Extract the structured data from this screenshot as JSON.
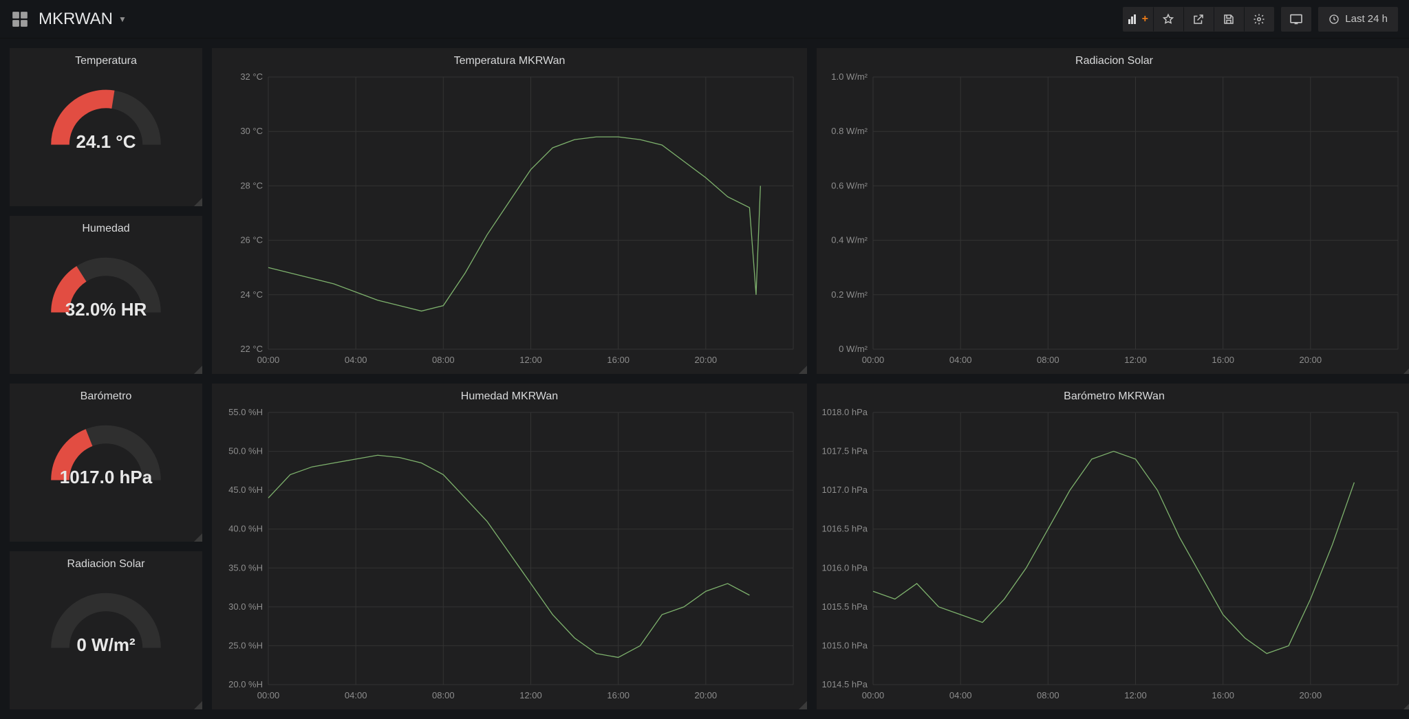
{
  "header": {
    "title": "MKRWAN",
    "time_label": "Last 24 h"
  },
  "gauges": {
    "temperatura": {
      "title": "Temperatura",
      "value": "24.1 °C",
      "fraction": 0.55,
      "color": "#e24d42"
    },
    "humedad": {
      "title": "Humedad",
      "value": "32.0% HR",
      "fraction": 0.32,
      "color": "#e24d42"
    },
    "barometro": {
      "title": "Barómetro",
      "value": "1017.0 hPa",
      "fraction": 0.38,
      "color": "#e24d42"
    },
    "radiacion": {
      "title": "Radiacion Solar",
      "value": "0 W/m²",
      "fraction": 0.0,
      "color": "#444444"
    }
  },
  "chart_data": [
    {
      "id": "temp",
      "type": "line",
      "title": "Temperatura MKRWan",
      "xlabel": "",
      "ylabel": "",
      "x_ticks": [
        "00:00",
        "04:00",
        "08:00",
        "12:00",
        "16:00",
        "20:00"
      ],
      "y_ticks": [
        "22 °C",
        "24 °C",
        "26 °C",
        "28 °C",
        "30 °C",
        "32 °C"
      ],
      "ylim": [
        22,
        32
      ],
      "series": [
        {
          "name": "temp",
          "x": [
            0,
            1,
            2,
            3,
            4,
            5,
            6,
            7,
            8,
            9,
            10,
            11,
            12,
            13,
            14,
            15,
            16,
            17,
            18,
            19,
            20,
            21,
            22,
            22.3,
            22.5
          ],
          "y": [
            25.0,
            24.8,
            24.6,
            24.4,
            24.1,
            23.8,
            23.6,
            23.4,
            23.6,
            24.8,
            26.2,
            27.4,
            28.6,
            29.4,
            29.7,
            29.8,
            29.8,
            29.7,
            29.5,
            28.9,
            28.3,
            27.6,
            27.2,
            24.0,
            28.0
          ]
        }
      ]
    },
    {
      "id": "solar",
      "type": "line",
      "title": "Radiacion Solar",
      "x_ticks": [
        "00:00",
        "04:00",
        "08:00",
        "12:00",
        "16:00",
        "20:00"
      ],
      "y_ticks": [
        "0 W/m²",
        "0.2 W/m²",
        "0.4 W/m²",
        "0.6 W/m²",
        "0.8 W/m²",
        "1.0 W/m²"
      ],
      "ylim": [
        0,
        1
      ],
      "series": []
    },
    {
      "id": "humedad",
      "type": "line",
      "title": "Humedad MKRWan",
      "x_ticks": [
        "00:00",
        "04:00",
        "08:00",
        "12:00",
        "16:00",
        "20:00"
      ],
      "y_ticks": [
        "20.0 %H",
        "25.0 %H",
        "30.0 %H",
        "35.0 %H",
        "40.0 %H",
        "45.0 %H",
        "50.0 %H",
        "55.0 %H"
      ],
      "ylim": [
        20,
        55
      ],
      "series": [
        {
          "name": "hum",
          "x": [
            0,
            1,
            2,
            3,
            4,
            5,
            6,
            7,
            8,
            9,
            10,
            11,
            12,
            13,
            14,
            15,
            16,
            17,
            18,
            19,
            20,
            21,
            22
          ],
          "y": [
            44,
            47,
            48,
            48.5,
            49,
            49.5,
            49.2,
            48.5,
            47,
            44,
            41,
            37,
            33,
            29,
            26,
            24,
            23.5,
            25,
            29,
            30,
            32,
            33,
            31.5
          ]
        }
      ]
    },
    {
      "id": "baro",
      "type": "line",
      "title": "Barómetro MKRWan",
      "x_ticks": [
        "00:00",
        "04:00",
        "08:00",
        "12:00",
        "16:00",
        "20:00"
      ],
      "y_ticks": [
        "1014.5 hPa",
        "1015.0 hPa",
        "1015.5 hPa",
        "1016.0 hPa",
        "1016.5 hPa",
        "1017.0 hPa",
        "1017.5 hPa",
        "1018.0 hPa"
      ],
      "ylim": [
        1014.5,
        1018
      ],
      "series": [
        {
          "name": "baro",
          "x": [
            0,
            1,
            2,
            3,
            4,
            5,
            6,
            7,
            8,
            9,
            10,
            11,
            12,
            13,
            14,
            15,
            16,
            17,
            18,
            19,
            20,
            21,
            22
          ],
          "y": [
            1015.7,
            1015.6,
            1015.8,
            1015.5,
            1015.4,
            1015.3,
            1015.6,
            1016.0,
            1016.5,
            1017.0,
            1017.4,
            1017.5,
            1017.4,
            1017.0,
            1016.4,
            1015.9,
            1015.4,
            1015.1,
            1014.9,
            1015.0,
            1015.6,
            1016.3,
            1017.1
          ]
        }
      ]
    }
  ]
}
